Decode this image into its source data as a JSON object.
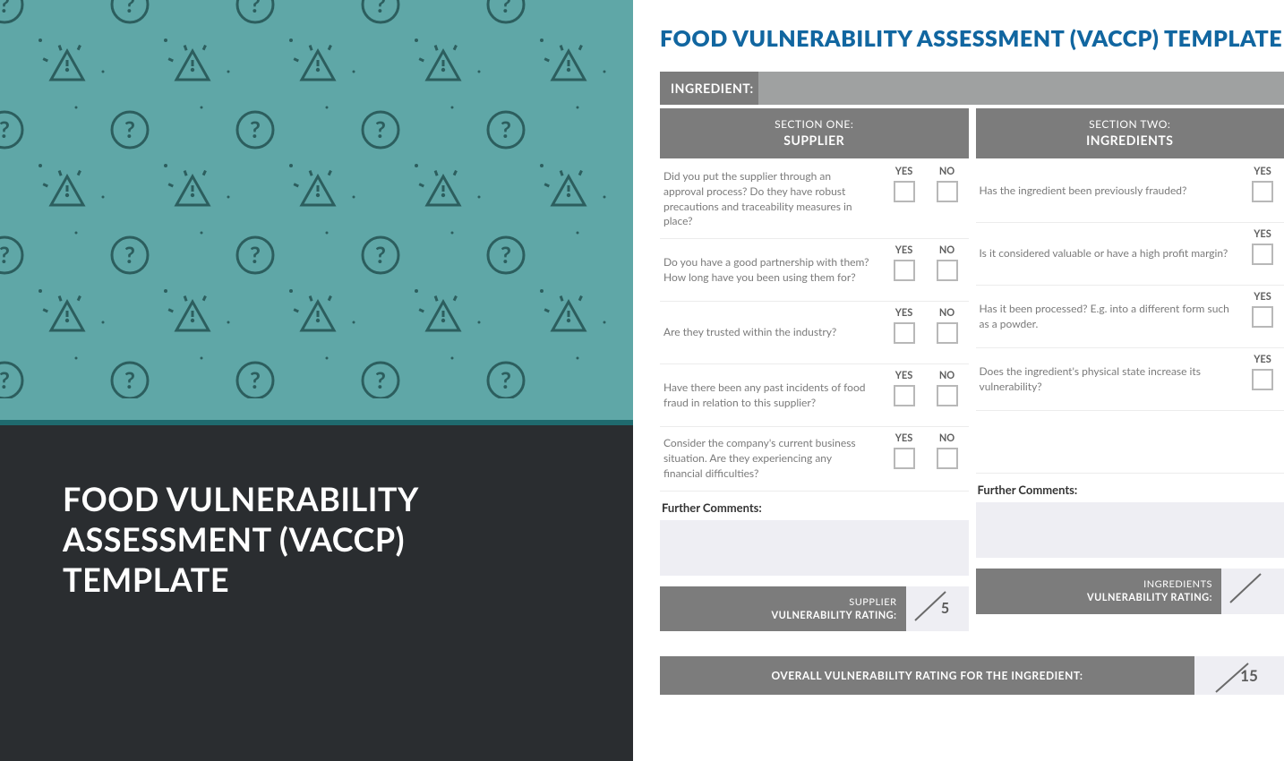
{
  "left": {
    "title": "FOOD VULNERABILITY ASSESSMENT (VACCP) TEMPLATE"
  },
  "form": {
    "title": "FOOD VULNERABILITY ASSESSMENT (VACCP) TEMPLATE",
    "ingredient_label": "INGREDIENT:",
    "yes": "YES",
    "no": "NO",
    "further_comments": "Further Comments:",
    "section1": {
      "line1": "SECTION ONE:",
      "line2": "SUPPLIER",
      "q1": "Did you put the supplier through an approval process? Do they have robust precautions and traceability measures in place?",
      "q2": "Do you have a good partnership with them? How long have you been using them for?",
      "q3": "Are they trusted within the industry?",
      "q4": "Have there been any past incidents of food fraud in relation to this supplier?",
      "q5": "Consider the company's current business situation. Are they experiencing any financial difficulties?",
      "rating_r1": "SUPPLIER",
      "rating_r2": "VULNERABILITY RATING:",
      "rating_max": "5"
    },
    "section2": {
      "line1": "SECTION TWO:",
      "line2": "INGREDIENTS",
      "q1": "Has the ingredient been previously frauded?",
      "q2": "Is it considered valuable or have a high profit margin?",
      "q3": "Has it been processed? E.g. into a different form such as a powder.",
      "q4": "Does the ingredient's physical state increase its vulnerability?",
      "rating_r1": "INGREDIENTS",
      "rating_r2": "VULNERABILITY RATING:",
      "rating_max": ""
    },
    "overall_label": "OVERALL VULNERABILITY RATING FOR THE INGREDIENT:",
    "overall_max": "15"
  }
}
